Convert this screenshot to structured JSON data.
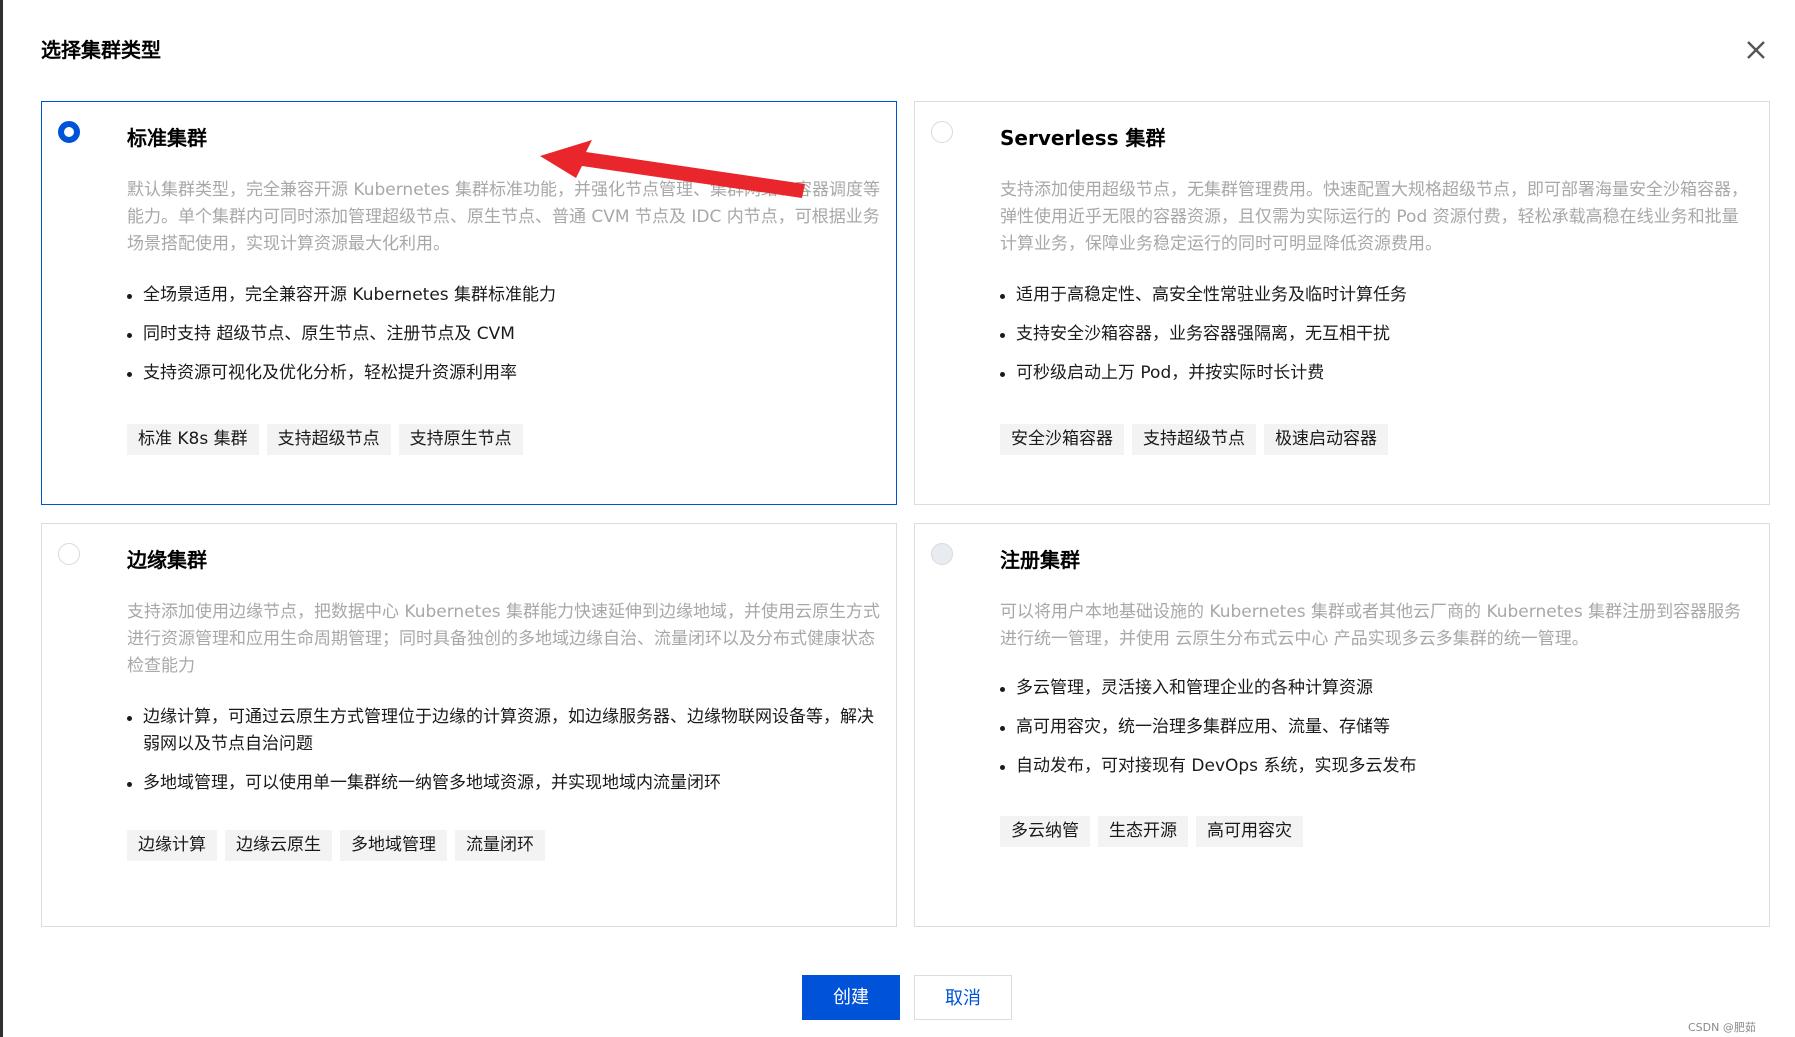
{
  "dialog": {
    "title": "选择集群类型",
    "close_icon": "close-icon"
  },
  "cards": [
    {
      "id": "standard",
      "title": "标准集群",
      "selected": true,
      "description": "默认集群类型，完全兼容开源 Kubernetes 集群标准功能，并强化节点管理、集群网络、容器调度等能力。单个集群内可同时添加管理超级节点、原生节点、普通 CVM 节点及 IDC 内节点，可根据业务场景搭配使用，实现计算资源最大化利用。",
      "features": [
        "全场景适用，完全兼容开源 Kubernetes 集群标准能力",
        "同时支持 超级节点、原生节点、注册节点及 CVM",
        "支持资源可视化及优化分析，轻松提升资源利用率"
      ],
      "tags": [
        "标准 K8s 集群",
        "支持超级节点",
        "支持原生节点"
      ]
    },
    {
      "id": "serverless",
      "title": "Serverless 集群",
      "selected": false,
      "description": "支持添加使用超级节点，无集群管理费用。快速配置大规格超级节点，即可部署海量安全沙箱容器，弹性使用近乎无限的容器资源，且仅需为实际运行的 Pod 资源付费，轻松承载高稳在线业务和批量计算业务，保障业务稳定运行的同时可明显降低资源费用。",
      "features": [
        "适用于高稳定性、高安全性常驻业务及临时计算任务",
        "支持安全沙箱容器，业务容器强隔离，无互相干扰",
        "可秒级启动上万 Pod，并按实际时长计费"
      ],
      "tags": [
        "安全沙箱容器",
        "支持超级节点",
        "极速启动容器"
      ]
    },
    {
      "id": "edge",
      "title": "边缘集群",
      "selected": false,
      "description": "支持添加使用边缘节点，把数据中心 Kubernetes 集群能力快速延伸到边缘地域，并使用云原生方式进行资源管理和应用生命周期管理；同时具备独创的多地域边缘自治、流量闭环以及分布式健康状态检查能力",
      "features": [
        "边缘计算，可通过云原生方式管理位于边缘的计算资源，如边缘服务器、边缘物联网设备等，解决弱网以及节点自治问题",
        "多地域管理，可以使用单一集群统一纳管多地域资源，并实现地域内流量闭环"
      ],
      "tags": [
        "边缘计算",
        "边缘云原生",
        "多地域管理",
        "流量闭环"
      ]
    },
    {
      "id": "registered",
      "title": "注册集群",
      "selected": false,
      "disabled": true,
      "description": "可以将用户本地基础设施的 Kubernetes 集群或者其他云厂商的 Kubernetes 集群注册到容器服务进行统一管理，并使用 云原生分布式云中心 产品实现多云多集群的统一管理。",
      "features": [
        "多云管理，灵活接入和管理企业的各种计算资源",
        "高可用容灾，统一治理多集群应用、流量、存储等",
        "自动发布，可对接现有 DevOps 系统，实现多云发布"
      ],
      "tags": [
        "多云纳管",
        "生态开源",
        "高可用容灾"
      ]
    }
  ],
  "footer": {
    "create_label": "创建",
    "cancel_label": "取消"
  },
  "watermark": "CSDN @肥茹",
  "colors": {
    "primary": "#0052d9",
    "annotation_arrow": "#e8262b"
  }
}
